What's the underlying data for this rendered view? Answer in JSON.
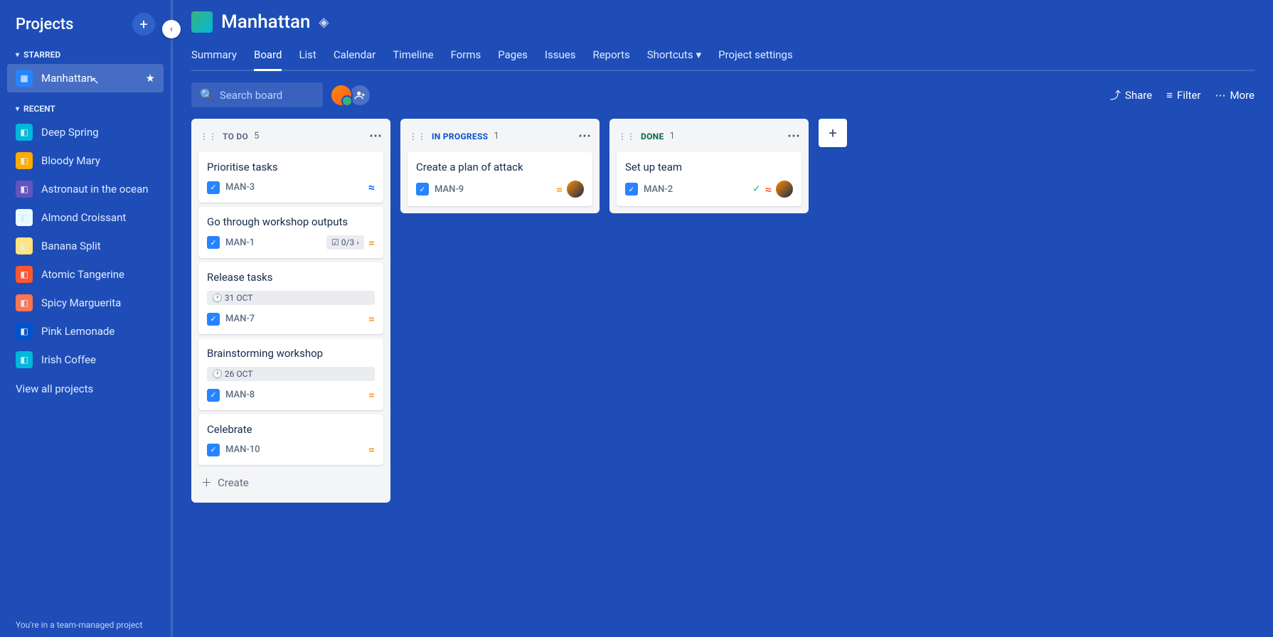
{
  "sidebar": {
    "title": "Projects",
    "starred_label": "STARRED",
    "recent_label": "RECENT",
    "starred": [
      {
        "name": "Manhattan",
        "color": "#2684ff"
      }
    ],
    "recent": [
      {
        "name": "Deep Spring",
        "color": "#00b8d9"
      },
      {
        "name": "Bloody Mary",
        "color": "#ffab00"
      },
      {
        "name": "Astronaut in the ocean",
        "color": "#6554c0"
      },
      {
        "name": "Almond Croissant",
        "color": "#e6fcff"
      },
      {
        "name": "Banana Split",
        "color": "#ffe380"
      },
      {
        "name": "Atomic Tangerine",
        "color": "#ff5630"
      },
      {
        "name": "Spicy Marguerita",
        "color": "#ff7452"
      },
      {
        "name": "Pink Lemonade",
        "color": "#0052cc"
      },
      {
        "name": "Irish Coffee",
        "color": "#00b8d9"
      }
    ],
    "view_all": "View all projects",
    "footer": "You're in a team-managed project"
  },
  "header": {
    "project_name": "Manhattan",
    "tabs": [
      "Summary",
      "Board",
      "List",
      "Calendar",
      "Timeline",
      "Forms",
      "Pages",
      "Issues",
      "Reports",
      "Shortcuts",
      "Project settings"
    ],
    "active_tab": "Board"
  },
  "toolbar": {
    "search_placeholder": "Search board",
    "share": "Share",
    "filter": "Filter",
    "more": "More"
  },
  "columns": [
    {
      "title": "TO DO",
      "class": "col-todo",
      "count": "5",
      "cards": [
        {
          "title": "Prioritise tasks",
          "key": "MAN-3",
          "priority": "lowest",
          "date": null,
          "subtasks": null,
          "done": false,
          "assignee": false
        },
        {
          "title": "Go through workshop outputs",
          "key": "MAN-1",
          "priority": "med",
          "date": null,
          "subtasks": "0/3",
          "done": false,
          "assignee": false
        },
        {
          "title": "Release tasks",
          "key": "MAN-7",
          "priority": "med",
          "date": "31 OCT",
          "subtasks": null,
          "done": false,
          "assignee": false
        },
        {
          "title": "Brainstorming workshop",
          "key": "MAN-8",
          "priority": "med",
          "date": "26 OCT",
          "subtasks": null,
          "done": false,
          "assignee": false
        },
        {
          "title": "Celebrate",
          "key": "MAN-10",
          "priority": "med",
          "date": null,
          "subtasks": null,
          "done": false,
          "assignee": false
        }
      ],
      "create": "Create"
    },
    {
      "title": "IN PROGRESS",
      "class": "col-progress",
      "count": "1",
      "cards": [
        {
          "title": "Create a plan of attack",
          "key": "MAN-9",
          "priority": "med",
          "date": null,
          "subtasks": null,
          "done": false,
          "assignee": true
        }
      ],
      "create": null
    },
    {
      "title": "DONE",
      "class": "col-done",
      "count": "1",
      "cards": [
        {
          "title": "Set up team",
          "key": "MAN-2",
          "priority": "high",
          "date": null,
          "subtasks": null,
          "done": true,
          "assignee": true
        }
      ],
      "create": null
    }
  ]
}
